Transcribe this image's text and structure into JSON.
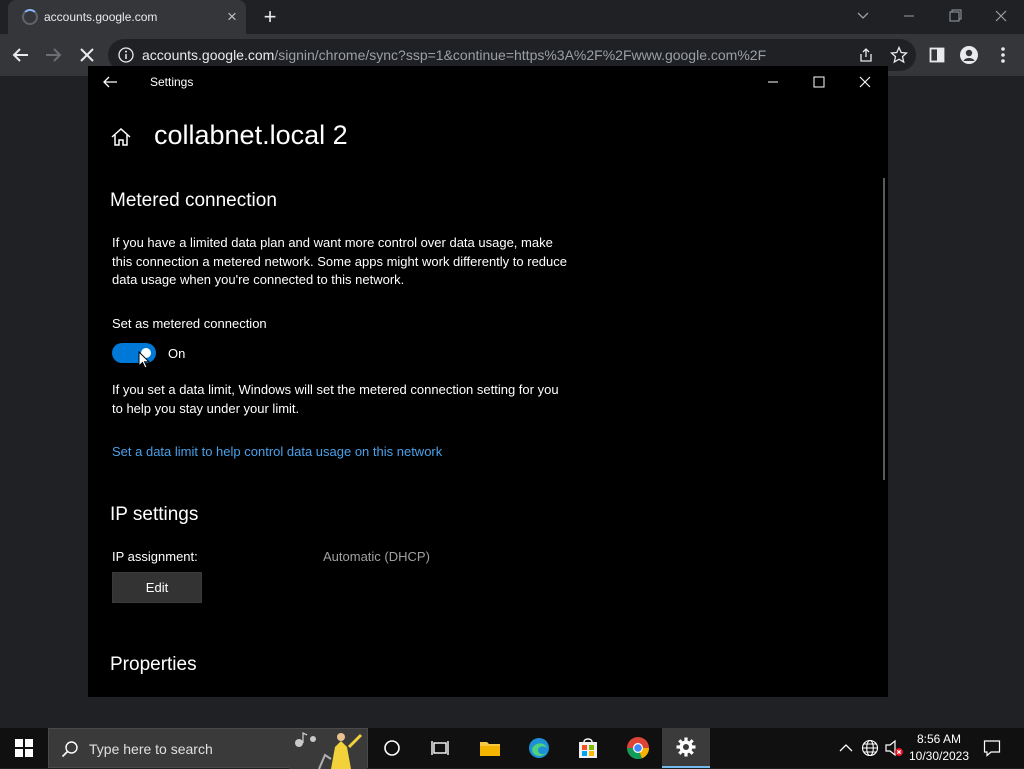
{
  "browser": {
    "tab_title": "accounts.google.com",
    "url_host": "accounts.google.com",
    "url_path": "/signin/chrome/sync?ssp=1&continue=https%3A%2F%2Fwww.google.com%2F"
  },
  "settings": {
    "app_title": "Settings",
    "page_title": "collabnet.local 2",
    "metered": {
      "heading": "Metered connection",
      "description": "If you have a limited data plan and want more control over data usage, make this connection a metered network. Some apps might work differently to reduce data usage when you're connected to this network.",
      "toggle_label": "Set as metered connection",
      "toggle_state": "On",
      "toggle_on": true,
      "limit_note": "If you set a data limit, Windows will set the metered connection setting for you to help you stay under your limit.",
      "limit_link": "Set a data limit to help control data usage on this network"
    },
    "ip": {
      "heading": "IP settings",
      "assignment_label": "IP assignment:",
      "assignment_value": "Automatic (DHCP)",
      "edit_label": "Edit"
    },
    "properties": {
      "heading": "Properties"
    }
  },
  "taskbar": {
    "search_placeholder": "Type here to search",
    "time": "8:56 AM",
    "date": "10/30/2023"
  },
  "colors": {
    "accent": "#0078d7",
    "link": "#4aa0e8",
    "chrome_dark": "#202124"
  }
}
